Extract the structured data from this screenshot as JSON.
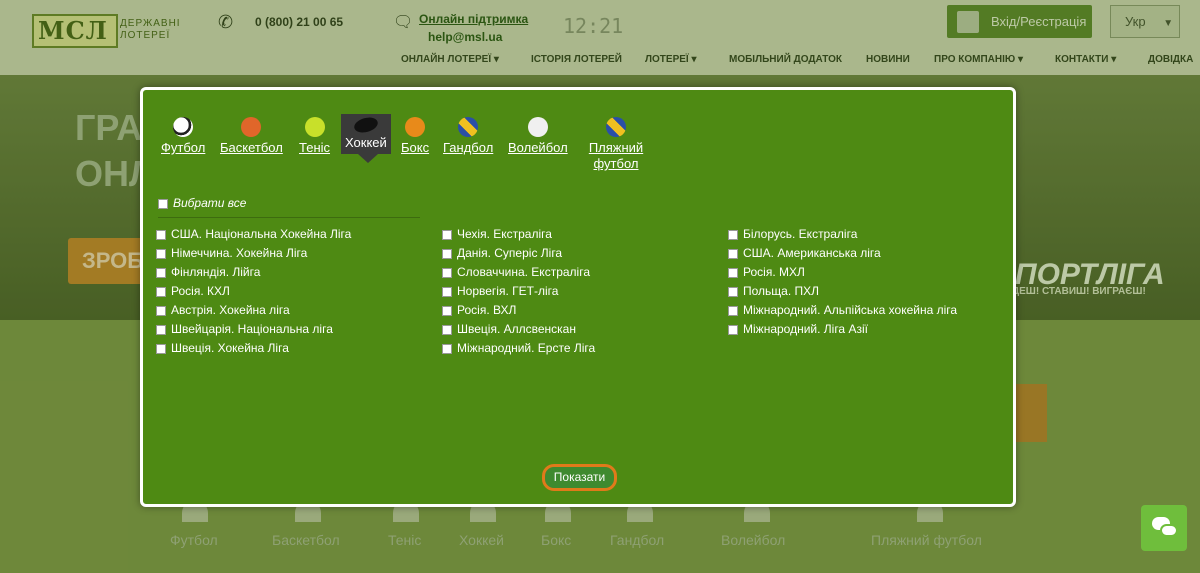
{
  "header": {
    "logo_text": "ДЕРЖАВНІ ЛОТЕРЕЇ",
    "logo_mark": "МСЛ",
    "phone": "0 (800) 21 00 65",
    "support_link": "Онлайн підтримка",
    "support_email": "help@msl.ua",
    "clock": "12:21",
    "login": "Вхід/Реєстрація",
    "language": "Укр"
  },
  "nav": [
    "ОНЛАЙН ЛОТЕРЕЇ",
    "ІСТОРІЯ ЛОТЕРЕЙ",
    "ЛОТЕРЕЇ",
    "МОБІЛЬНИЙ ДОДАТОК",
    "НОВИНИ",
    "ПРО КОМПАНІЮ",
    "КОНТАКТИ",
    "ДОВІДКА"
  ],
  "hero": {
    "line1": "ГРА",
    "line2": "ОНЛ",
    "button": "ЗРОБ",
    "brand": "ПОРТЛІГА",
    "slogan": "ДЕШ! СТАВИШ! ВИГРАЄШ!"
  },
  "background_tabs": [
    "Футбол",
    "Баскетбол",
    "Теніс",
    "Хоккей",
    "Бокс",
    "Гандбол",
    "Волейбол",
    "Пляжний футбол"
  ],
  "modal": {
    "tabs": [
      {
        "label": "Футбол",
        "color": "#ffffff"
      },
      {
        "label": "Баскетбол",
        "color": "#e0662a"
      },
      {
        "label": "Теніс",
        "color": "#c8e02a"
      },
      {
        "label": "Хоккей",
        "color": "#111111"
      },
      {
        "label": "Бокс",
        "color": "#e88a1a"
      },
      {
        "label": "Гандбол",
        "color": "#2a4fa8"
      },
      {
        "label": "Волейбол",
        "color": "#f0f0f0"
      },
      {
        "label": "Пляжний футбол",
        "color": "#2a4fa8"
      }
    ],
    "active_tab": "Хоккей",
    "select_all": "Вибрати все",
    "col1": [
      "США. Національна Хокейна Ліга",
      "Німеччина. Хокейна Ліга",
      "Фінляндія. Лійга",
      "Росія. КХЛ",
      "Австрія. Хокейна ліга",
      "Швейцарія. Національна ліга",
      "Швеція. Хокейна Ліга"
    ],
    "col2": [
      "Чехія. Екстраліга",
      "Данія. Суперіс Ліга",
      "Словаччина. Екстраліга",
      "Норвегія. ГЕТ-ліга",
      "Росія. ВХЛ",
      "Швеція. Аллсвенскан",
      "Міжнародний. Ерсте Ліга"
    ],
    "col3": [
      "Білорусь. Екстраліга",
      "США. Американська ліга",
      "Росія. МХЛ",
      "Польща. ПХЛ",
      "Міжнародний. Альпійська хокейна ліга",
      "Міжнародний. Ліга Азії"
    ],
    "show_button": "Показати"
  }
}
